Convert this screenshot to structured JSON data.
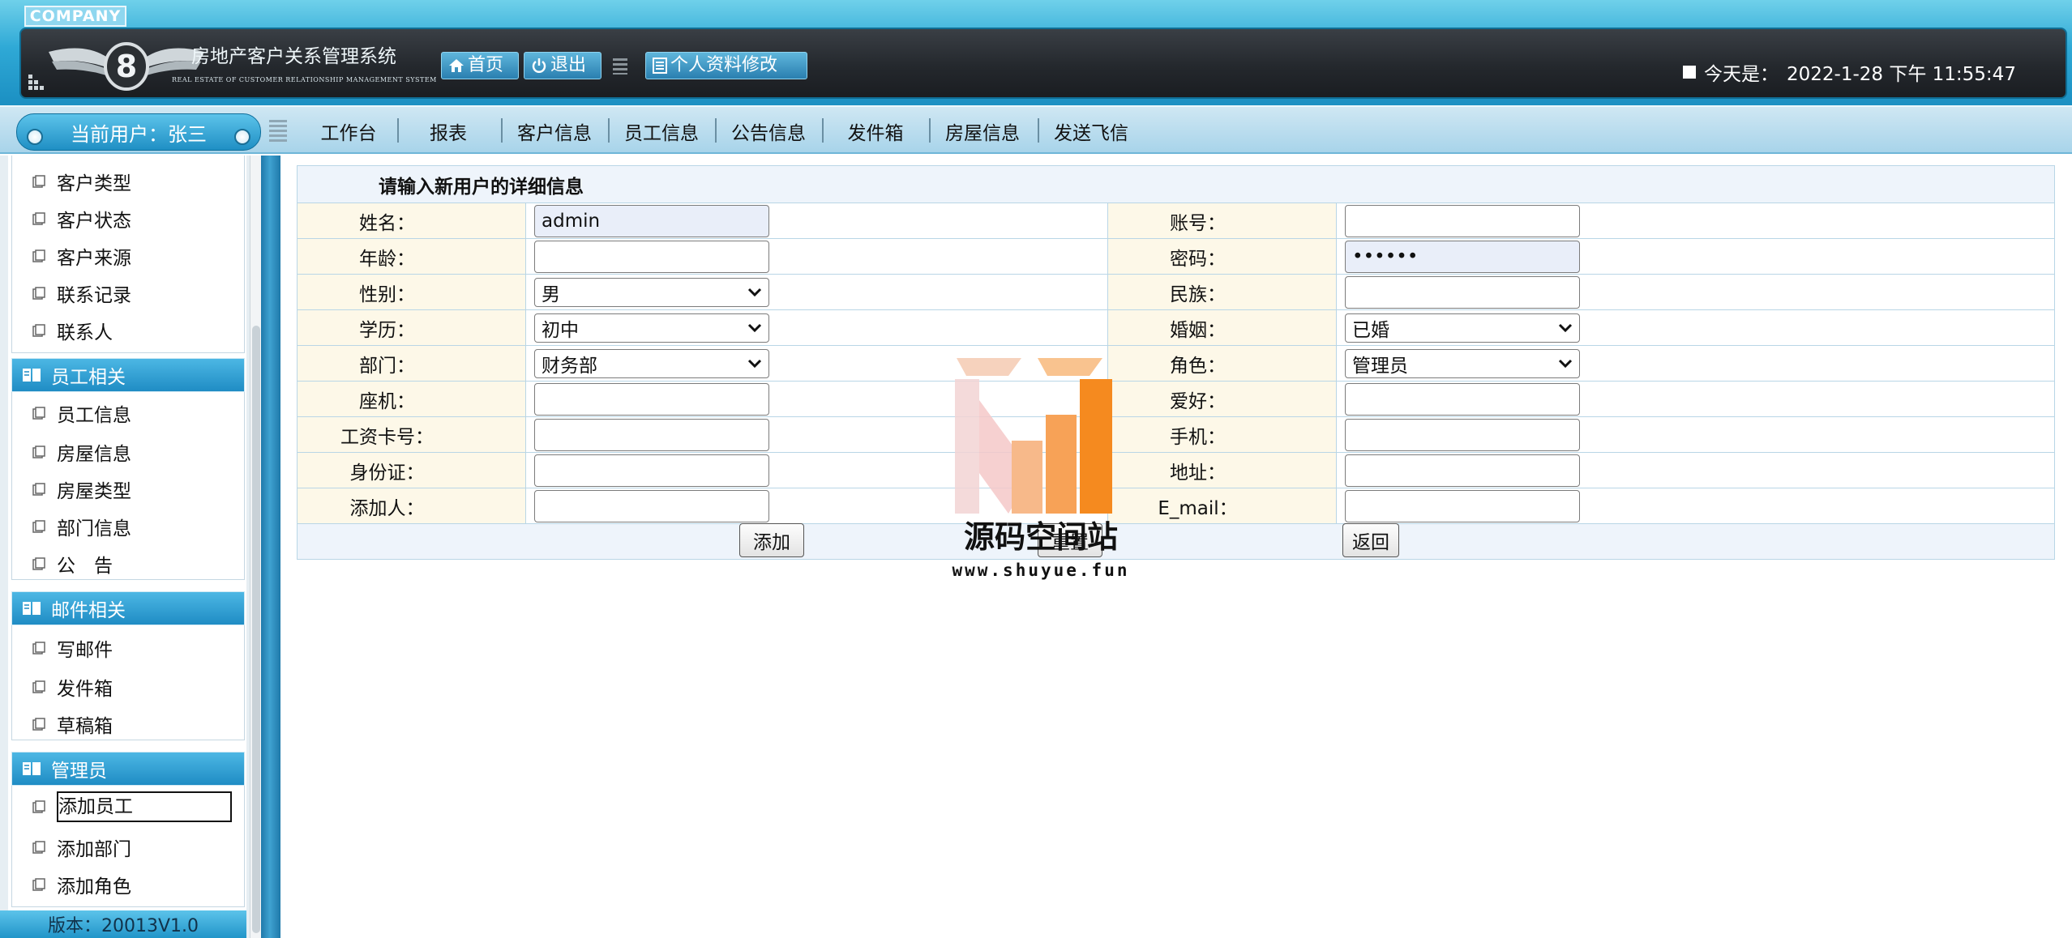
{
  "header": {
    "company_tag": "COMPANY",
    "system_title": "房地产客户关系管理系统",
    "system_subtitle": "REAL ESTATE OF CUSTOMER RELATIONSHIP MANAGEMENT SYSTEM",
    "home_label": "首页",
    "exit_label": "退出",
    "profile_label": "个人资料修改",
    "today_label": "今天是：",
    "today_value": "2022-1-28 下午 11:55:47"
  },
  "nav": {
    "current_user": "当前用户：张三",
    "items": [
      "工作台",
      "报表",
      "客户信息",
      "员工信息",
      "公告信息",
      "发件箱",
      "房屋信息",
      "发送飞信"
    ]
  },
  "sidebar": {
    "customer_items": [
      "客户类型",
      "客户状态",
      "客户来源",
      "联系记录",
      "联系人"
    ],
    "sections": [
      {
        "title": "员工相关",
        "items": [
          "员工信息",
          "房屋信息",
          "房屋类型",
          "部门信息",
          "公　告"
        ]
      },
      {
        "title": "邮件相关",
        "items": [
          "写邮件",
          "发件箱",
          "草稿箱"
        ]
      },
      {
        "title": "管理员",
        "items": [
          "添加员工",
          "添加部门",
          "添加角色"
        ]
      }
    ],
    "version": "版本：20013V1.0"
  },
  "form": {
    "title": "请输入新用户的详细信息",
    "left": [
      {
        "label": "姓名：",
        "value": "admin",
        "type": "text"
      },
      {
        "label": "年龄：",
        "value": "",
        "type": "text"
      },
      {
        "label": "性别：",
        "value": "男",
        "type": "select"
      },
      {
        "label": "学历：",
        "value": "初中",
        "type": "select"
      },
      {
        "label": "部门：",
        "value": "财务部",
        "type": "select"
      },
      {
        "label": "座机：",
        "value": "",
        "type": "text"
      },
      {
        "label": "工资卡号：",
        "value": "",
        "type": "text"
      },
      {
        "label": "身份证：",
        "value": "",
        "type": "text"
      },
      {
        "label": "添加人：",
        "value": "",
        "type": "text"
      }
    ],
    "right": [
      {
        "label": "账号：",
        "value": "",
        "type": "text"
      },
      {
        "label": "密码：",
        "value": "••••••",
        "type": "password"
      },
      {
        "label": "民族：",
        "value": "",
        "type": "text"
      },
      {
        "label": "婚姻：",
        "value": "已婚",
        "type": "select"
      },
      {
        "label": "角色：",
        "value": "管理员",
        "type": "select"
      },
      {
        "label": "爱好：",
        "value": "",
        "type": "text"
      },
      {
        "label": "手机：",
        "value": "",
        "type": "text"
      },
      {
        "label": "地址：",
        "value": "",
        "type": "text"
      },
      {
        "label": "E_mail：",
        "value": "",
        "type": "text"
      }
    ],
    "add_button": "添加",
    "reset_button": "重置",
    "back_button": "返回"
  },
  "watermark": {
    "title": "源码空间站",
    "url": "www.shuyue.fun"
  },
  "colors": {
    "header_blue": "#2fa9d6",
    "header_dark": "#24282d",
    "label_bg": "#fdf8e8",
    "section_blue": "#1f8cc4",
    "watermark_orange": "#f58a1f"
  }
}
